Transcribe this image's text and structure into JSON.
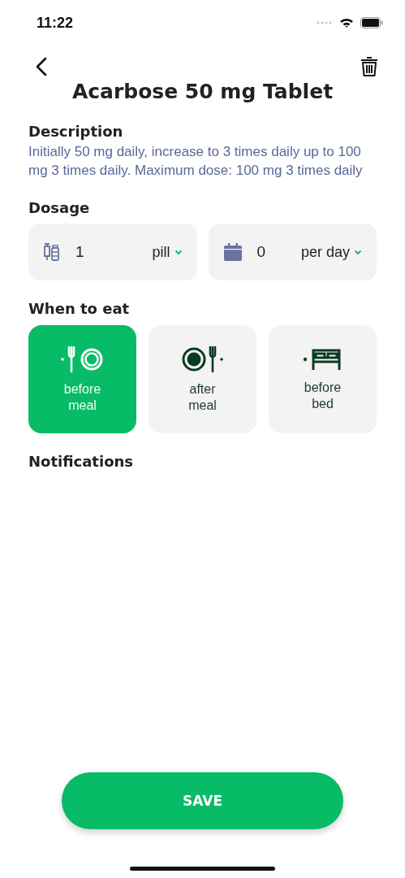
{
  "status_bar": {
    "time": "11:22"
  },
  "title": "Acarbose 50 mg Tablet",
  "description": {
    "heading": "Description",
    "text": "Initially 50 mg daily, increase to 3 times daily up to 100 mg 3 times daily. Maximum dose: 100 mg 3 times daily"
  },
  "dosage": {
    "heading": "Dosage",
    "fields": [
      {
        "kind": "amount",
        "value": "1",
        "unit": "pill"
      },
      {
        "kind": "frequency",
        "value": "0",
        "unit": "per day"
      }
    ]
  },
  "when_to_eat": {
    "heading": "When to eat",
    "options": [
      {
        "kind": "before_meal",
        "label": "before meal",
        "selected": true
      },
      {
        "kind": "after_meal",
        "label": "after meal",
        "selected": false
      },
      {
        "kind": "before_bed",
        "label": "before bed",
        "selected": false
      }
    ]
  },
  "notifications": {
    "heading": "Notifications"
  },
  "save_button": "SAVE"
}
